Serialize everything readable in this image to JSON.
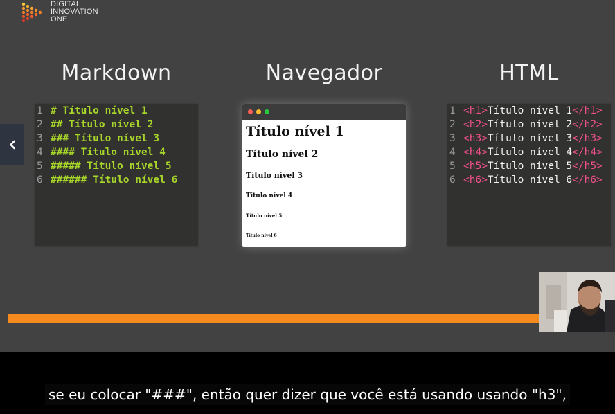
{
  "logo": {
    "line1": "DIGITAL",
    "line2": "INNOVATION",
    "line3": "ONE"
  },
  "columns": {
    "markdown_title": "Markdown",
    "browser_title": "Navegador",
    "html_title": "HTML"
  },
  "markdown_lines": [
    {
      "num": "1",
      "text": "# Título nível 1"
    },
    {
      "num": "2",
      "text": "## Título nível 2"
    },
    {
      "num": "3",
      "text": "### Título nível 3"
    },
    {
      "num": "4",
      "text": "#### Título nível 4"
    },
    {
      "num": "5",
      "text": "##### Título nível 5"
    },
    {
      "num": "6",
      "text": "###### Título nível 6"
    }
  ],
  "browser_headings": [
    "Título nível 1",
    "Título nível 2",
    "Título nível 3",
    "Título nível 4",
    "Título nível 5",
    "Título nível 6"
  ],
  "html_lines": [
    {
      "num": "1",
      "open": "<h1>",
      "text": "Título nível 1",
      "close": "</h1>"
    },
    {
      "num": "2",
      "open": "<h2>",
      "text": "Título nível 2",
      "close": "</h2>"
    },
    {
      "num": "3",
      "open": "<h3>",
      "text": "Título nível 3",
      "close": "</h3>"
    },
    {
      "num": "4",
      "open": "<h4>",
      "text": "Título nível 4",
      "close": "</h4>"
    },
    {
      "num": "5",
      "open": "<h5>",
      "text": "Título nível 5",
      "close": "</h5>"
    },
    {
      "num": "6",
      "open": "<h6>",
      "text": "Título nível 6",
      "close": "</h6>"
    }
  ],
  "player": {
    "prev_icon": "chevron-left-icon",
    "progress_fraction": 0.9
  },
  "caption": "se eu colocar \"###\", então quer dizer que você está usando usando \"h3\",",
  "colors": {
    "slide_bg": "#424242",
    "markdown_text": "#a8d52a",
    "html_tag": "#f0508a",
    "progress": "#f58a1f",
    "dot_red": "#ff5f56",
    "dot_yellow": "#ffbd2e",
    "dot_green": "#27c93f"
  }
}
